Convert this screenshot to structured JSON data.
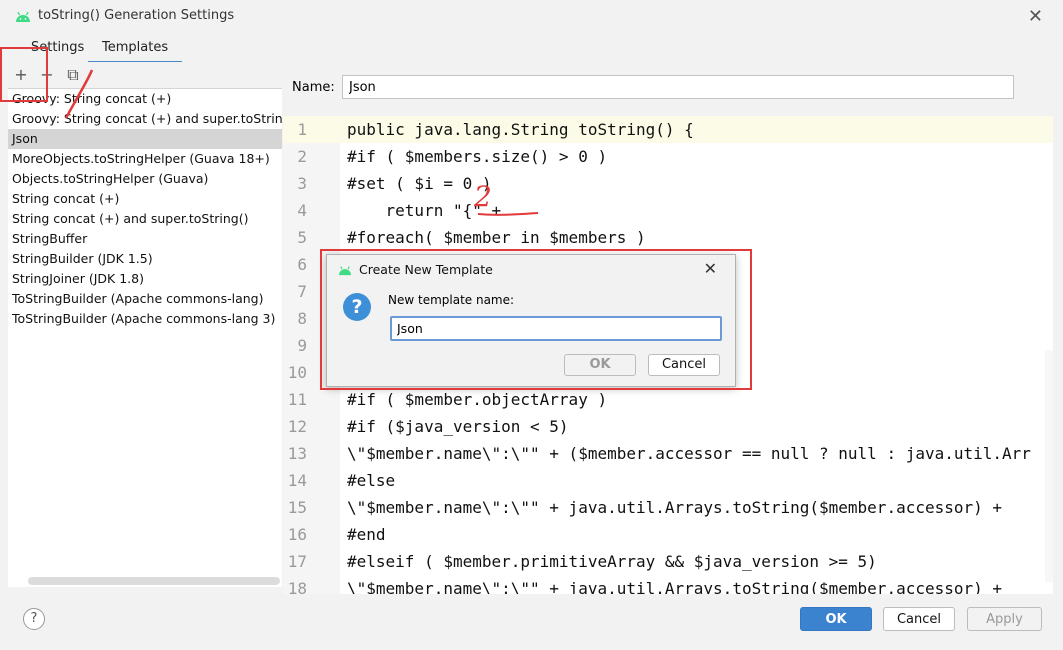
{
  "window": {
    "title": "toString() Generation Settings"
  },
  "tabs": [
    {
      "label": "Settings"
    },
    {
      "label": "Templates"
    }
  ],
  "toolbar": {
    "add": "+",
    "remove": "−",
    "copy": "⧉"
  },
  "templates": [
    "Groovy: String concat (+)",
    "Groovy: String concat (+) and super.toString()",
    "Json",
    "MoreObjects.toStringHelper (Guava 18+)",
    "Objects.toStringHelper (Guava)",
    "String concat (+)",
    "String concat (+) and super.toString()",
    "StringBuffer",
    "StringBuilder (JDK 1.5)",
    "StringJoiner (JDK 1.8)",
    "ToStringBuilder (Apache commons-lang)",
    "ToStringBuilder (Apache commons-lang 3)"
  ],
  "selected_template": "Json",
  "name": {
    "label": "Name:",
    "value": "Json"
  },
  "code_lines": [
    "public java.lang.String toString() {",
    "#if ( $members.size() > 0 )",
    "#set ( $i = 0 )",
    "    return \"{\" +",
    "#foreach( $member in $members )",
    "",
    "",
    "",
    "",
    "",
    "#if ( $member.objectArray )",
    "#if ($java_version < 5)",
    "\\\"$member.name\\\":\\\"\" + ($member.accessor == null ? null : java.util.Arr",
    "#else",
    "\\\"$member.name\\\":\\\"\" + java.util.Arrays.toString($member.accessor) +",
    "#end",
    "#elseif ( $member.primitiveArray && $java_version >= 5)",
    "\\\"$member.name\\\":\\\"\" + java.util.Arrays.toString($member.accessor) +"
  ],
  "line_numbers": [
    "1",
    "2",
    "3",
    "4",
    "5",
    "6",
    "7",
    "8",
    "9",
    "10",
    "11",
    "12",
    "13",
    "14",
    "15",
    "16",
    "17",
    "18"
  ],
  "dialog": {
    "title": "Create New Template",
    "prompt": "New template name:",
    "value": "Json",
    "ok": "OK",
    "cancel": "Cancel"
  },
  "footer": {
    "help": "?",
    "ok": "OK",
    "cancel": "Cancel",
    "apply": "Apply"
  },
  "annotations": {
    "step2": "2"
  },
  "colors": {
    "accent": "#3c83cf",
    "annotation_red": "#e03a3a",
    "android_green": "#3ddc84"
  }
}
